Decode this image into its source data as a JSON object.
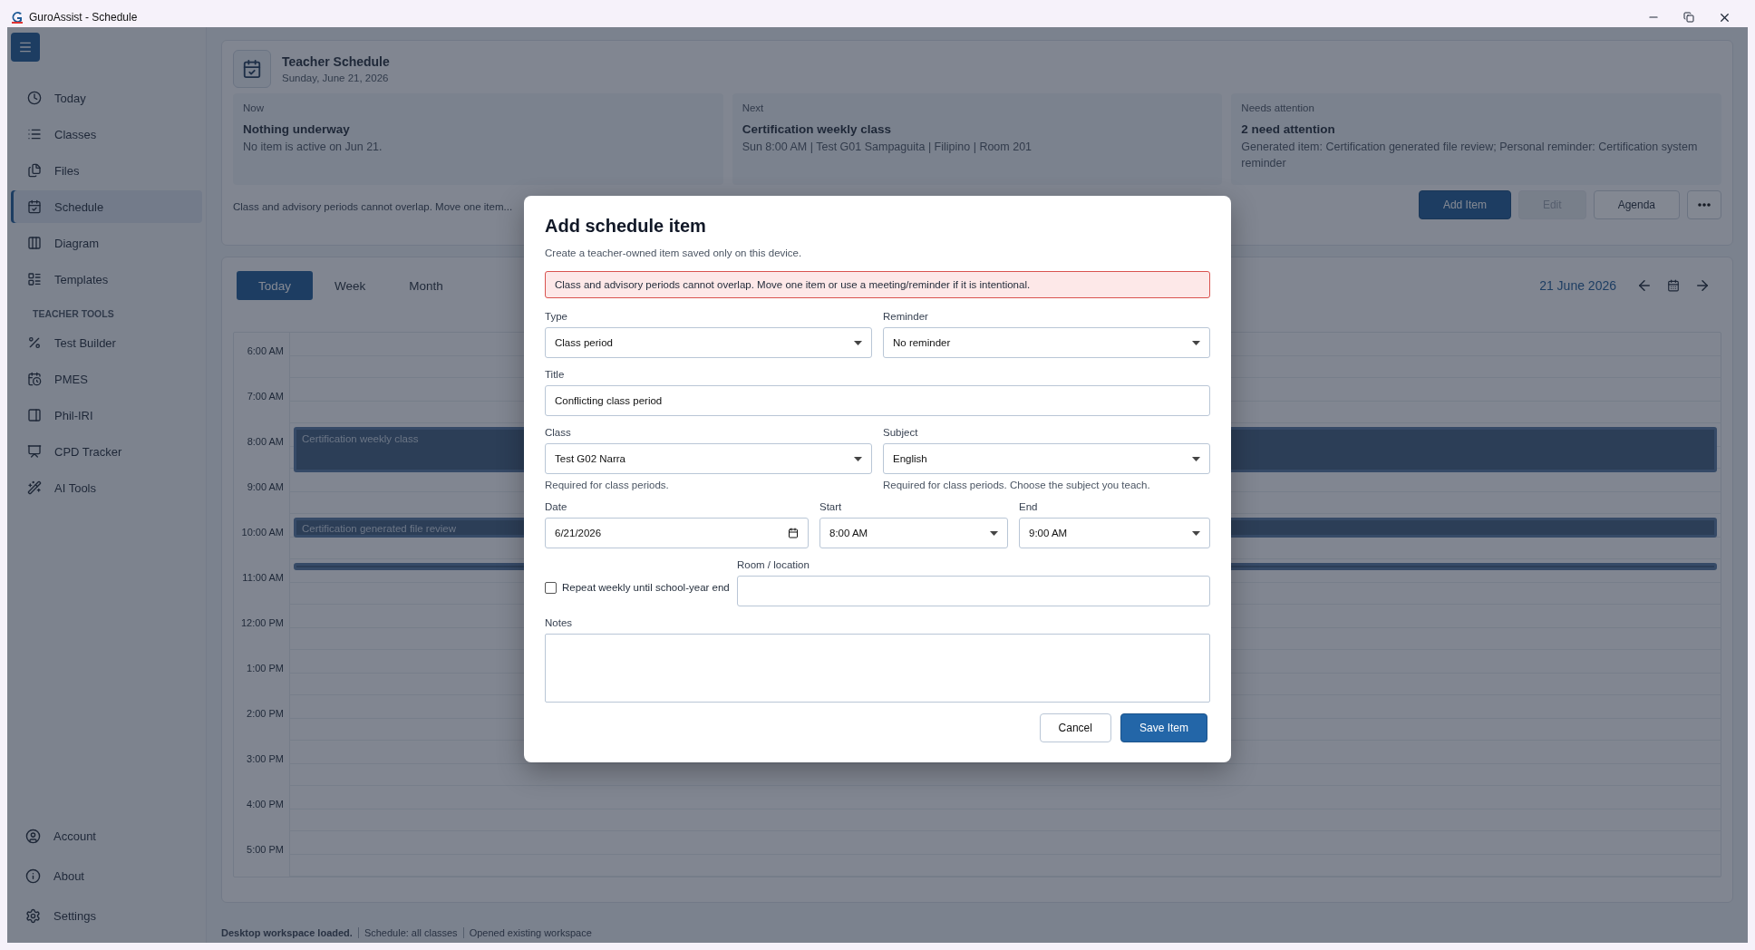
{
  "window": {
    "title": "GuroAssist - Schedule"
  },
  "sidebar": {
    "nav_items": [
      {
        "label": "Today",
        "selected": false
      },
      {
        "label": "Classes",
        "selected": false
      },
      {
        "label": "Files",
        "selected": false
      },
      {
        "label": "Schedule",
        "selected": true
      },
      {
        "label": "Diagram",
        "selected": false
      },
      {
        "label": "Templates",
        "selected": false
      }
    ],
    "section_label": "TEACHER TOOLS",
    "tools": [
      {
        "label": "Test Builder",
        "selected": false
      },
      {
        "label": "PMES",
        "selected": false
      },
      {
        "label": "Phil-IRI",
        "selected": false
      },
      {
        "label": "CPD Tracker",
        "selected": false
      },
      {
        "label": "AI Tools",
        "selected": false
      }
    ],
    "bottom_items": [
      {
        "label": "Account"
      },
      {
        "label": "About"
      },
      {
        "label": "Settings"
      }
    ]
  },
  "header": {
    "title": "Teacher Schedule",
    "date": "Sunday, June 21, 2026",
    "cards": [
      {
        "label": "Now",
        "heading": "Nothing underway",
        "detail": "No item is active on Jun 21."
      },
      {
        "label": "Next",
        "heading": "Certification weekly class",
        "detail": "Sun 8:00 AM | Test G01 Sampaguita | Filipino | Room 201"
      },
      {
        "label": "Needs attention",
        "heading": "2 need attention",
        "detail": "Generated item: Certification generated file review; Personal reminder: Certification system reminder"
      }
    ],
    "notice": "Class and advisory periods cannot overlap. Move one item...",
    "actions": [
      {
        "label": "Add Item",
        "kind": "primary",
        "disabled": false
      },
      {
        "label": "Edit",
        "kind": "outline",
        "disabled": true
      },
      {
        "label": "Agenda",
        "kind": "outline",
        "disabled": false
      }
    ]
  },
  "calendar": {
    "views": [
      {
        "label": "Today",
        "selected": true
      },
      {
        "label": "Week",
        "selected": false
      },
      {
        "label": "Month",
        "selected": false
      }
    ],
    "date_label": "21 June 2026",
    "hours": [
      {
        "label": "6:00 AM"
      },
      {
        "label": "7:00 AM"
      },
      {
        "label": "8:00 AM",
        "events": [
          {
            "kind": "full",
            "title": "Certification weekly class"
          }
        ]
      },
      {
        "label": "9:00 AM"
      },
      {
        "label": "10:00 AM",
        "events": [
          {
            "kind": "short",
            "title": "Certification generated file review"
          }
        ]
      },
      {
        "label": "11:00 AM",
        "events": [
          {
            "kind": "thin"
          }
        ]
      },
      {
        "label": "12:00 PM"
      },
      {
        "label": "1:00 PM"
      },
      {
        "label": "2:00 PM"
      },
      {
        "label": "3:00 PM"
      },
      {
        "label": "4:00 PM"
      },
      {
        "label": "5:00 PM"
      }
    ]
  },
  "status_bar": [
    {
      "text": "Desktop workspace loaded.",
      "kind": "strong"
    },
    {
      "text": "Schedule: all classes",
      "kind": "plain"
    },
    {
      "text": "Opened existing workspace",
      "kind": "plain"
    }
  ],
  "dialog": {
    "title": "Add schedule item",
    "subtitle": "Create a teacher-owned item saved only on this device.",
    "error": "Class and advisory periods cannot overlap. Move one item or use a meeting/reminder if it is intentional.",
    "type": {
      "label": "Type",
      "value": "Class period"
    },
    "reminder": {
      "label": "Reminder",
      "value": "No reminder"
    },
    "title_field": {
      "label": "Title",
      "value": "Conflicting class period"
    },
    "class": {
      "label": "Class",
      "value": "Test G02 Narra",
      "hint": "Required for class periods."
    },
    "subject": {
      "label": "Subject",
      "value": "English",
      "hint": "Required for class periods. Choose the subject you teach."
    },
    "date": {
      "label": "Date",
      "value": "6/21/2026"
    },
    "start": {
      "label": "Start",
      "value": "8:00 AM"
    },
    "end": {
      "label": "End",
      "value": "9:00 AM"
    },
    "repeat": {
      "label": "Repeat weekly until school-year end",
      "checked": false
    },
    "room": {
      "label": "Room / location"
    },
    "notes": {
      "label": "Notes"
    },
    "buttons": [
      {
        "label": "Cancel",
        "kind": "secondary"
      },
      {
        "label": "Save Item",
        "kind": "primary"
      }
    ]
  }
}
